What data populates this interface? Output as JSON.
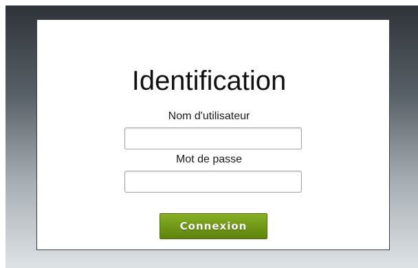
{
  "login": {
    "title": "Identification",
    "username_label": "Nom d'utilisateur",
    "username_value": "",
    "password_label": "Mot de passe",
    "password_value": "",
    "submit_label": "Connexion"
  },
  "colors": {
    "accent": "#6f9616",
    "panel_border": "#3c3f42",
    "backdrop_top": "#2e3338",
    "backdrop_bottom": "#dde2e5"
  }
}
